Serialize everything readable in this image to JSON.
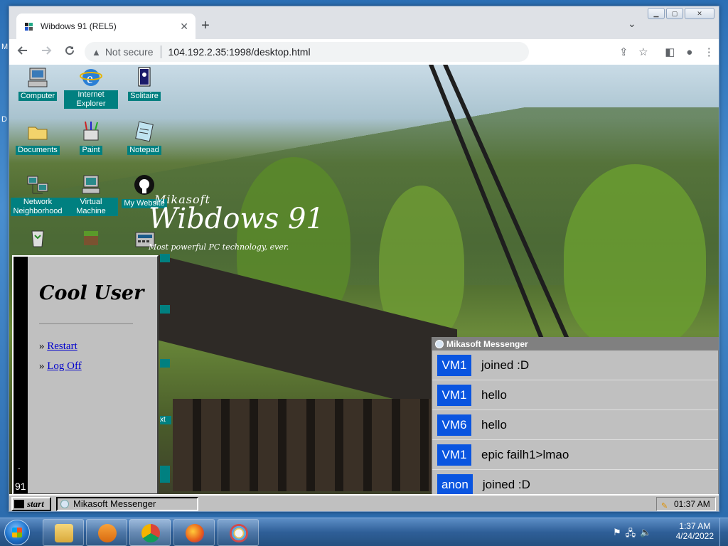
{
  "browser": {
    "tab_title": "Wibdows 91 (REL5)",
    "tab_close": "✕",
    "new_tab": "+",
    "tab_search": "⌄",
    "security_label": "Not secure",
    "url": "104.192.2.35:1998/desktop.html",
    "window_controls": [
      "▁",
      "▢",
      "✕"
    ]
  },
  "win7_stray": [
    "M",
    "D"
  ],
  "desktop_icons": [
    {
      "label": "Computer",
      "icon": "computer-icon"
    },
    {
      "label": "Internet Explorer",
      "icon": "internet-explorer-icon"
    },
    {
      "label": "Solitaire",
      "icon": "solitaire-icon"
    },
    {
      "label": "Documents",
      "icon": "folder-icon"
    },
    {
      "label": "Paint",
      "icon": "paint-icon"
    },
    {
      "label": "Notepad",
      "icon": "notepad-icon"
    },
    {
      "label": "Network Neighborhood",
      "icon": "network-icon"
    },
    {
      "label": "Virtual Machine",
      "icon": "virtual-machine-icon"
    },
    {
      "label": "My Website",
      "icon": "github-icon"
    }
  ],
  "brand": {
    "company": "Mikasoft",
    "product": "Wibdows 91",
    "tagline": "Most powerful PC technology, ever."
  },
  "partial_label": "xt",
  "start_menu": {
    "user_name": "Cool User",
    "items": [
      "Restart",
      "Log Off"
    ],
    "bullet": "»",
    "version": "91",
    "smile": "ᵕ"
  },
  "messenger": {
    "title": "Mikasoft Messenger",
    "messages": [
      {
        "who": "VM1",
        "text": "joined :D"
      },
      {
        "who": "VM1",
        "text": "hello"
      },
      {
        "who": "VM6",
        "text": "hello"
      },
      {
        "who": "VM1",
        "text": "epic failh1>lmao"
      },
      {
        "who": "anon",
        "text": "joined :D"
      }
    ]
  },
  "w91_taskbar": {
    "start_label": "start",
    "task_button": "Mikasoft Messenger",
    "clock": "01:37 AM"
  },
  "win7_taskbar": {
    "time": "1:37 AM",
    "date": "4/24/2022",
    "pinned": [
      "explorer-icon",
      "media-player-icon",
      "chrome-icon",
      "firefox-icon",
      "paint-icon"
    ]
  }
}
